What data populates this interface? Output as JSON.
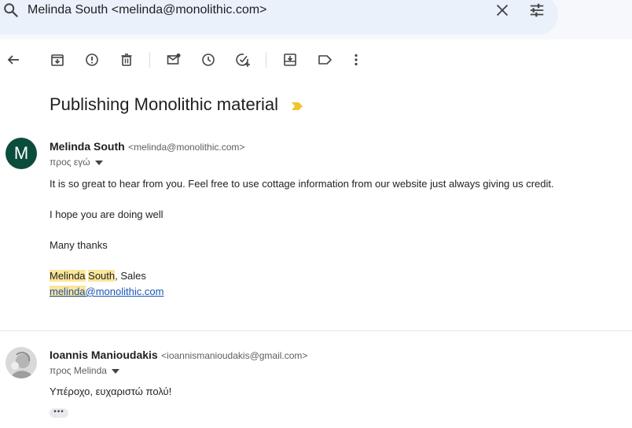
{
  "search": {
    "query": "Melinda South <melinda@monolithic.com>"
  },
  "toolbar": {
    "icons": [
      "back-icon",
      "archive-icon",
      "report-spam-icon",
      "delete-icon",
      "mark-unread-icon",
      "snooze-icon",
      "add-to-tasks-icon",
      "move-to-icon",
      "labels-icon",
      "more-icon"
    ]
  },
  "thread": {
    "subject": "Publishing Monolithic material",
    "label_color": "#f4c430"
  },
  "messages": [
    {
      "avatar_letter": "M",
      "avatar_color": "#0b4d3c",
      "sender_name": "Melinda South",
      "sender_email": "<melinda@monolithic.com>",
      "recipient": "προς εγώ",
      "paragraphs": {
        "p1": "It is so great to hear from you. Feel free to use cottage information from our website just always giving us credit.",
        "p2": "I hope you are doing well",
        "p3": "Many thanks"
      },
      "signature": {
        "first": "Melinda",
        "last": "South",
        "rest": ", Sales",
        "email_user": "melinda",
        "email_domain": "@monolithic.com"
      }
    },
    {
      "sender_name": "Ioannis Manioudakis",
      "sender_email": "<ioannismanioudakis@gmail.com>",
      "recipient": "προς Melinda",
      "body": "Υπέροχο, ευχαριστώ πολύ!",
      "more": "•••"
    }
  ]
}
